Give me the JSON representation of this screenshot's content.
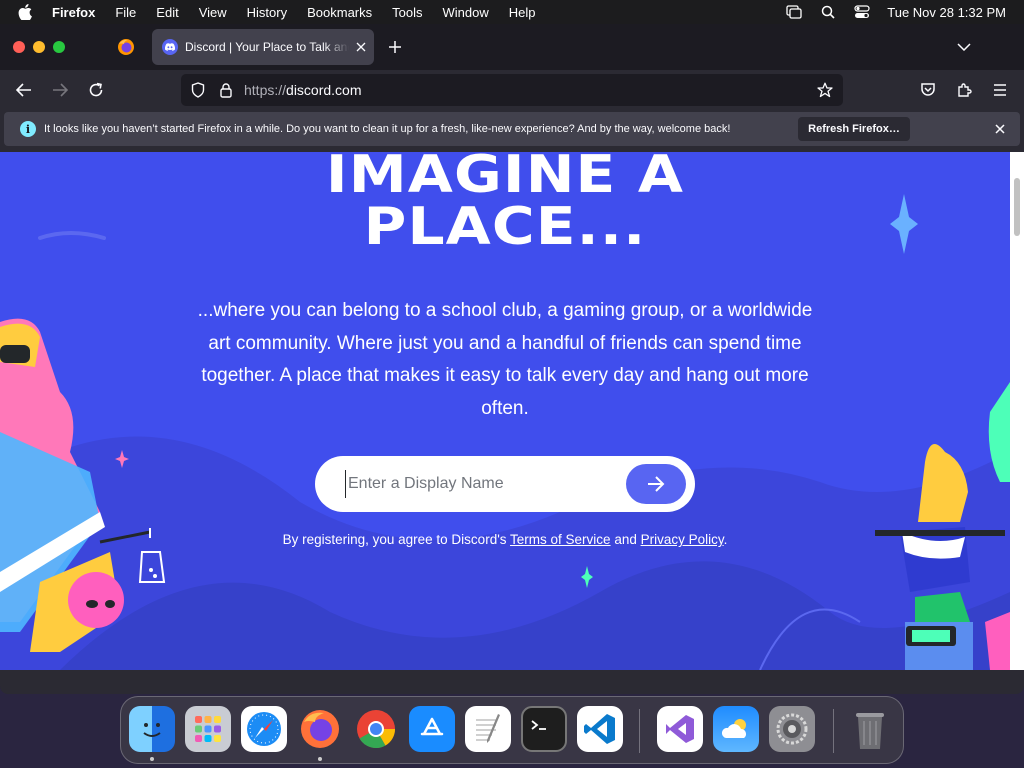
{
  "menubar": {
    "app_name": "Firefox",
    "items": [
      "File",
      "Edit",
      "View",
      "History",
      "Bookmarks",
      "Tools",
      "Window",
      "Help"
    ],
    "clock": "Tue Nov 28  1:32 PM"
  },
  "browser": {
    "tab_title": "Discord | Your Place to Talk and Hang Out",
    "url_protocol": "https://",
    "url_host": "discord.com",
    "notification": {
      "text": "It looks like you haven’t started Firefox in a while. Do you want to clean it up for a fresh, like-new experience? And by the way, welcome back!",
      "button_label": "Refresh Firefox…"
    }
  },
  "page": {
    "title_line1": "IMAGINE A",
    "title_line2": "PLACE...",
    "description": "...where you can belong to a school club, a gaming group, or a worldwide art community. Where just you and a handful of friends can spend time together. A place that makes it easy to talk every day and hang out more often.",
    "display_name_placeholder": "Enter a Display Name",
    "display_name_value": "",
    "legal_prefix": "By registering, you agree to Discord's ",
    "terms_link": "Terms of Service",
    "legal_and": " and ",
    "privacy_link": "Privacy Policy",
    "legal_suffix": "."
  },
  "dock": {
    "apps": [
      "finder",
      "launchpad",
      "safari",
      "firefox",
      "chrome",
      "app-store",
      "textedit",
      "terminal",
      "vscode",
      "visual-studio",
      "weather",
      "system-settings",
      "trash"
    ]
  },
  "colors": {
    "blurple": "#404eed",
    "button": "#5865f2",
    "firefox_chrome": "#2b2a33"
  }
}
